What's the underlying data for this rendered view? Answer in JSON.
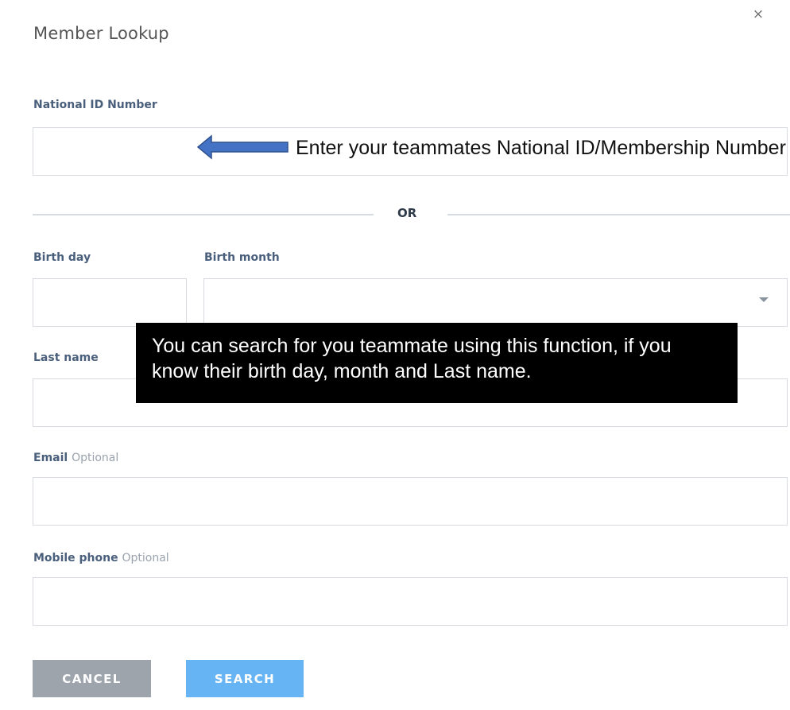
{
  "dialog": {
    "title": "Member Lookup",
    "close_glyph": "×"
  },
  "national_id": {
    "label": "National ID Number",
    "value": "",
    "annotation": "Enter your teammates National ID/Membership Number"
  },
  "divider": {
    "text": "OR"
  },
  "birth_day": {
    "label": "Birth day",
    "value": ""
  },
  "birth_month": {
    "label": "Birth month",
    "selected": ""
  },
  "last_name": {
    "label": "Last name",
    "value": ""
  },
  "callout": {
    "text": "You can search for you teammate using this function, if you know their birth day, month and Last name."
  },
  "email": {
    "label": "Email",
    "optional": "Optional",
    "value": ""
  },
  "mobile_phone": {
    "label": "Mobile phone",
    "optional": "Optional",
    "value": ""
  },
  "buttons": {
    "cancel": "CANCEL",
    "search": "SEARCH"
  },
  "colors": {
    "label": "#4a5f7c",
    "cancel_bg": "#9da4ac",
    "search_bg": "#67b4f5",
    "arrow_fill": "#4472c4",
    "arrow_stroke": "#2f528f"
  }
}
